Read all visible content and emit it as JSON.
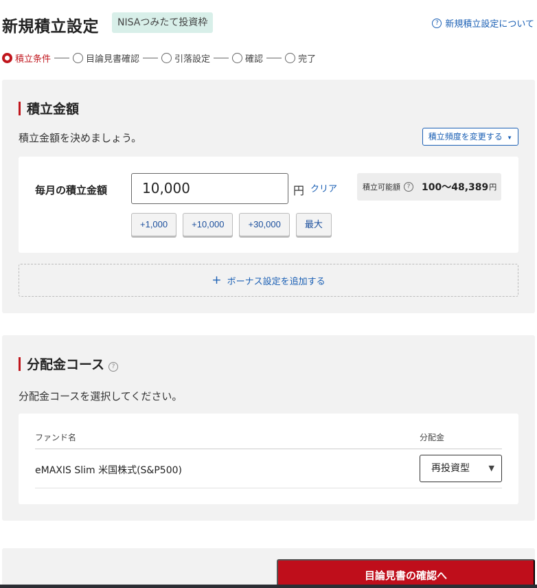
{
  "header": {
    "title": "新規積立設定",
    "badge": "NISAつみたて投資枠",
    "help_link": "新規積立設定について"
  },
  "stepper": {
    "steps": [
      {
        "label": "積立条件",
        "active": true
      },
      {
        "label": "目論見書確認",
        "active": false
      },
      {
        "label": "引落設定",
        "active": false
      },
      {
        "label": "確認",
        "active": false
      },
      {
        "label": "完了",
        "active": false
      }
    ]
  },
  "amount_section": {
    "title": "積立金額",
    "description": "積立金額を決めましょう。",
    "frequency_button": "積立頻度を変更する",
    "frequency_caret": "▼",
    "monthly_label": "毎月の積立金額",
    "input_value": "10,000",
    "unit": "円",
    "clear_link": "クリア",
    "range_label": "積立可能額",
    "range_value": "100〜48,389",
    "range_unit": "円",
    "quick_buttons": [
      "+1,000",
      "+10,000",
      "+30,000",
      "最大"
    ],
    "bonus_link": "ボーナス設定を追加する"
  },
  "course_section": {
    "title": "分配金コース",
    "description": "分配金コースを選択してください。",
    "table": {
      "headers": {
        "fund": "ファンド名",
        "distribution": "分配金"
      },
      "rows": [
        {
          "fund": "eMAXIS Slim 米国株式(S&P500)",
          "distribution": "再投資型"
        }
      ]
    }
  },
  "footer": {
    "confirm_button": "目論見書の確認へ"
  },
  "colors": {
    "accent_red": "#c0161d",
    "link_blue": "#1a5fb4",
    "badge_bg": "#d8efe9",
    "panel_bg": "#f2f2f2"
  },
  "icons": {
    "help": "question-circle-icon",
    "plus": "plus-icon",
    "caret": "chevron-down-icon"
  }
}
